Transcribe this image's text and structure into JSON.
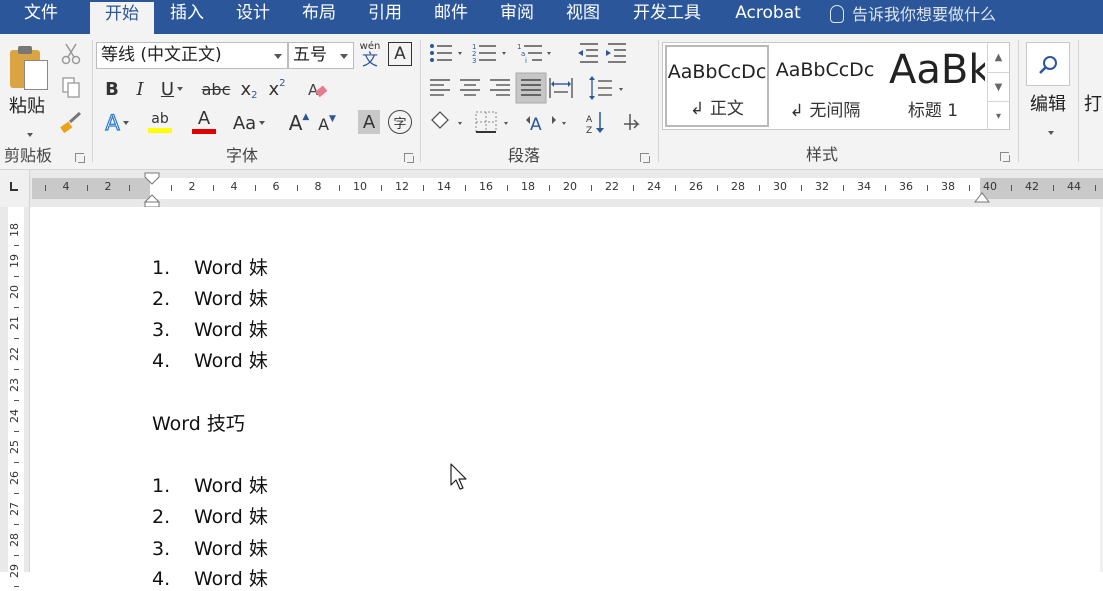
{
  "tabs": [
    "文件",
    "开始",
    "插入",
    "设计",
    "布局",
    "引用",
    "邮件",
    "审阅",
    "视图",
    "开发工具",
    "Acrobat"
  ],
  "active_tab": "开始",
  "tell_me": "告诉我你想要做什么",
  "clipboard": {
    "paste_label": "粘贴",
    "group_label": "剪贴板"
  },
  "font": {
    "font_name": "等线 (中文正文)",
    "font_size": "五号",
    "phonetic_guide": "wén",
    "phonetic_char": "文",
    "char_border": "A",
    "bold": "B",
    "italic": "I",
    "underline": "U",
    "strikethrough": "abc",
    "subscript": "x",
    "sub_mark": "2",
    "superscript": "x",
    "sup_mark": "2",
    "text_effects": "A",
    "highlight": "ab",
    "font_color": "A",
    "change_case": "Aa",
    "grow_font": "A",
    "shrink_font": "A",
    "char_shading": "A",
    "enclose_char": "字",
    "group_label": "字体",
    "highlight_color": "#ffff00",
    "font_color_value": "#e00000"
  },
  "paragraph": {
    "group_label": "段落"
  },
  "styles": {
    "items": [
      {
        "sample": "AaBbCcDc",
        "name": "↲ 正文",
        "selected": true
      },
      {
        "sample": "AaBbCcDc",
        "name": "↲ 无间隔",
        "selected": false
      },
      {
        "sample": "AaBk",
        "name": "标题 1",
        "selected": false
      }
    ],
    "group_label": "样式"
  },
  "editing": {
    "label": "编辑",
    "cut_label": "打"
  },
  "ruler": {
    "horizontal_labels": [
      "4",
      "2",
      "2",
      "4",
      "6",
      "8",
      "10",
      "12",
      "14",
      "16",
      "18",
      "20",
      "22",
      "24",
      "26",
      "28",
      "30",
      "32",
      "34",
      "36",
      "38",
      "40",
      "42",
      "44"
    ],
    "vertical_labels": [
      "18",
      "19",
      "20",
      "21",
      "22",
      "23",
      "24",
      "25",
      "26",
      "27",
      "28",
      "29"
    ]
  },
  "document": {
    "lines": [
      {
        "num": "1.",
        "text": "Word 妹"
      },
      {
        "num": "2.",
        "text": "Word 妹"
      },
      {
        "num": "3.",
        "text": "Word 妹"
      },
      {
        "num": "4.",
        "text": "Word 妹"
      },
      {
        "num": "",
        "text": "Word 技巧"
      },
      {
        "num": "1.",
        "text": "Word 妹"
      },
      {
        "num": "2.",
        "text": "Word 妹"
      },
      {
        "num": "3.",
        "text": "Word 妹"
      },
      {
        "num": "4.",
        "text": "Word 妹"
      }
    ]
  },
  "colors": {
    "accent": "#2b579a",
    "ribbon_bg": "#f3f3f3"
  }
}
